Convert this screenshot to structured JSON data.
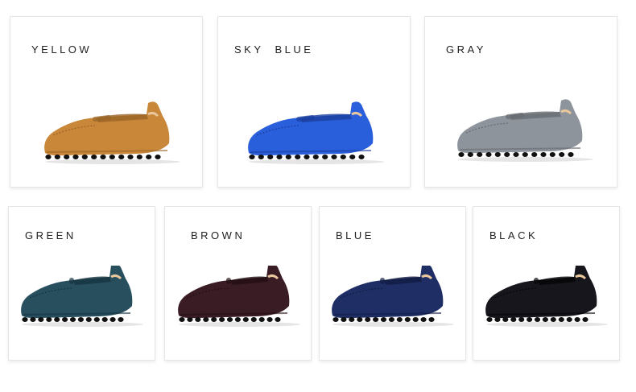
{
  "colors": [
    {
      "label": "YELLOW",
      "hex": "#c9873a",
      "dark": "#9a6425"
    },
    {
      "label": "SKY  BLUE",
      "hex": "#2a5fdb",
      "dark": "#1a3e9e"
    },
    {
      "label": "GRAY",
      "hex": "#8e949b",
      "dark": "#666b71"
    },
    {
      "label": "GREEN",
      "hex": "#274f5e",
      "dark": "#163340"
    },
    {
      "label": "BROWN",
      "hex": "#3a1d24",
      "dark": "#230f14"
    },
    {
      "label": "BLUE",
      "hex": "#1f2f66",
      "dark": "#121c42"
    },
    {
      "label": "BLACK",
      "hex": "#16161c",
      "dark": "#050507"
    }
  ]
}
